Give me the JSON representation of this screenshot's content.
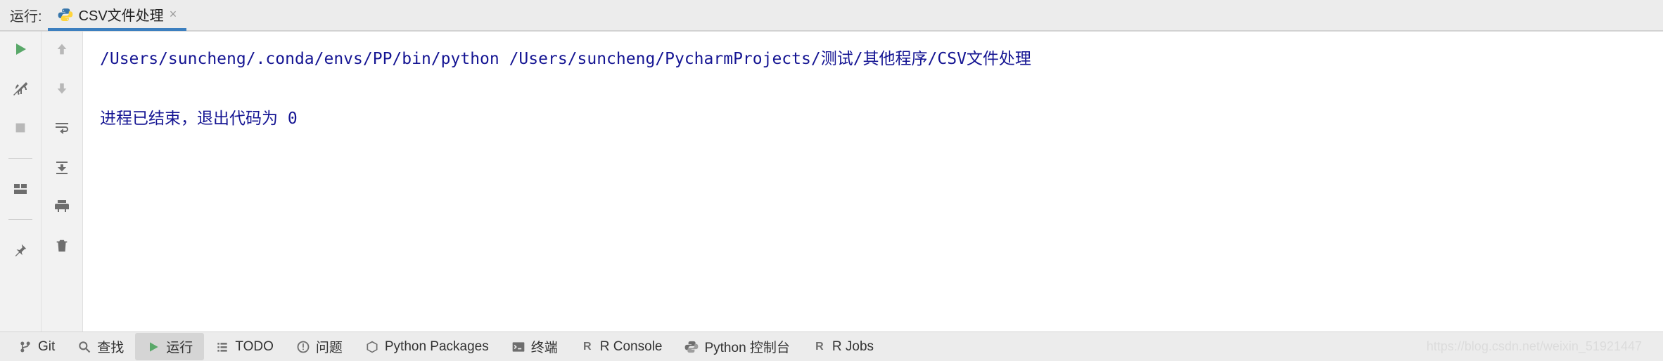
{
  "header": {
    "run_label": "运行:",
    "tab": {
      "title": "CSV文件处理",
      "icon": "python-file-icon"
    }
  },
  "console": {
    "line1": "/Users/suncheng/.conda/envs/PP/bin/python /Users/suncheng/PycharmProjects/测试/其他程序/CSV文件处理",
    "line2": "",
    "line3": "进程已结束，退出代码为 0"
  },
  "gutter_a": {
    "run": "run-icon",
    "debug": "wrench-icon",
    "stop": "stop-icon",
    "layout": "layout-icon",
    "pin": "pin-icon"
  },
  "gutter_b": {
    "up": "arrow-up-icon",
    "down": "arrow-down-icon",
    "wrap": "soft-wrap-icon",
    "scroll": "scroll-to-end-icon",
    "print": "print-icon",
    "trash": "trash-icon"
  },
  "bottom": {
    "items": [
      {
        "icon": "git-branch-icon",
        "label": "Git"
      },
      {
        "icon": "search-icon",
        "label": "查找"
      },
      {
        "icon": "play-icon",
        "label": "运行",
        "active": true
      },
      {
        "icon": "todo-icon",
        "label": "TODO"
      },
      {
        "icon": "problems-icon",
        "label": "问题"
      },
      {
        "icon": "packages-icon",
        "label": "Python Packages"
      },
      {
        "icon": "terminal-icon",
        "label": "终端"
      },
      {
        "icon": "r-icon",
        "label": "R Console"
      },
      {
        "icon": "python-icon",
        "label": "Python 控制台"
      },
      {
        "icon": "r-icon",
        "label": "R Jobs"
      }
    ]
  },
  "watermark": "https://blog.csdn.net/weixin_51921447"
}
